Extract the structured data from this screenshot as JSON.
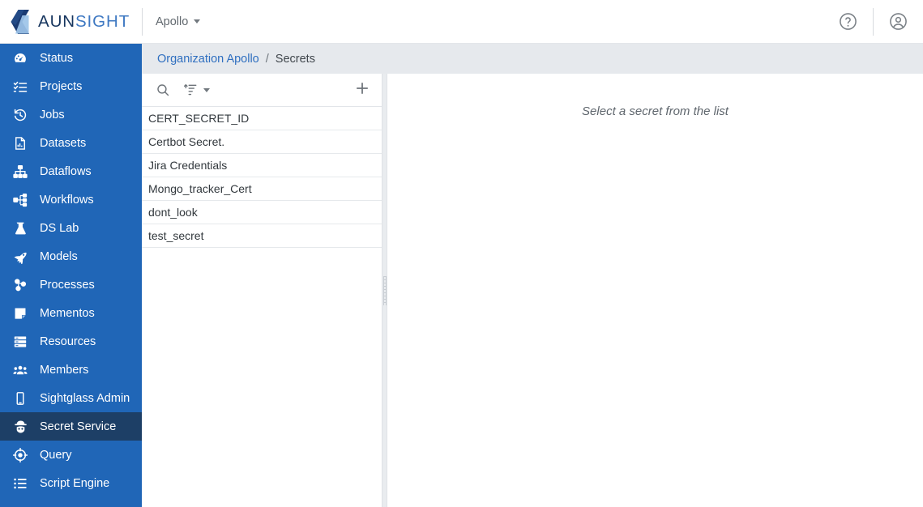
{
  "brand": {
    "name_part1": "AUN",
    "name_part2": "SIGHT",
    "logo_icon": "aunsight-logo-icon",
    "navy": "#16355e",
    "blue": "#3e78c2"
  },
  "topbar": {
    "org_label": "Apollo",
    "org_caret_icon": "chevron-down-icon",
    "help_icon": "help-circle-icon",
    "account_icon": "account-circle-icon"
  },
  "sidebar": {
    "background": "#2066b7",
    "active_background": "#1d3f66",
    "items": [
      {
        "label": "Status",
        "icon": "gauge-icon",
        "active": false
      },
      {
        "label": "Projects",
        "icon": "checklist-icon",
        "active": false
      },
      {
        "label": "Jobs",
        "icon": "history-icon",
        "active": false
      },
      {
        "label": "Datasets",
        "icon": "file-chart-icon",
        "active": false
      },
      {
        "label": "Dataflows",
        "icon": "sitemap-icon",
        "active": false
      },
      {
        "label": "Workflows",
        "icon": "workflow-icon",
        "active": false
      },
      {
        "label": "DS Lab",
        "icon": "flask-icon",
        "active": false
      },
      {
        "label": "Models",
        "icon": "rocket-icon",
        "active": false
      },
      {
        "label": "Processes",
        "icon": "molecule-icon",
        "active": false
      },
      {
        "label": "Mementos",
        "icon": "note-icon",
        "active": false
      },
      {
        "label": "Resources",
        "icon": "server-icon",
        "active": false
      },
      {
        "label": "Members",
        "icon": "people-icon",
        "active": false
      },
      {
        "label": "Sightglass Admin",
        "icon": "tablet-icon",
        "active": false
      },
      {
        "label": "Secret Service",
        "icon": "spy-icon",
        "active": true
      },
      {
        "label": "Query",
        "icon": "target-icon",
        "active": false
      },
      {
        "label": "Script Engine",
        "icon": "list-icon",
        "active": false
      }
    ]
  },
  "breadcrumb": {
    "organization": "Organization Apollo",
    "separator": "/",
    "current": "Secrets"
  },
  "list_toolbar": {
    "search_icon": "search-icon",
    "sort_icon": "sort-icon",
    "sort_caret_icon": "chevron-down-icon",
    "add_icon": "plus-icon"
  },
  "secrets_list": {
    "items": [
      {
        "name": "CERT_SECRET_ID"
      },
      {
        "name": "Certbot Secret."
      },
      {
        "name": "Jira Credentials"
      },
      {
        "name": "Mongo_tracker_Cert"
      },
      {
        "name": "dont_look"
      },
      {
        "name": "test_secret"
      }
    ]
  },
  "detail": {
    "placeholder": "Select a secret from the list"
  }
}
